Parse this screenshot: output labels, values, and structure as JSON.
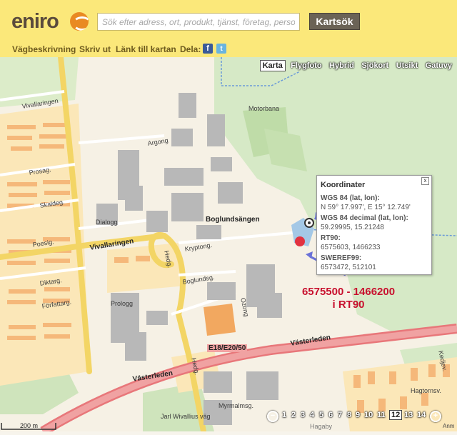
{
  "header": {
    "logo": "eniro",
    "search_placeholder": "Sök efter adress, ort, produkt, tjänst, företag, person",
    "search_button": "Kartsök"
  },
  "toolbar": {
    "directions": "Vägbeskrivning",
    "print": "Skriv ut",
    "link": "Länk till kartan",
    "share": "Dela:",
    "facebook": "f",
    "twitter": "t"
  },
  "map_types": [
    "Karta",
    "Flygfoto",
    "Hybrid",
    "Sjökort",
    "Utsikt",
    "Gatuvy"
  ],
  "map_labels": {
    "motorbana": "Motorbana",
    "vivallaringen_top": "Vivallaringen",
    "argong": "Argong",
    "prosag": "Prosag.",
    "skaldeg": "Skaldeg.",
    "dialogg": "Dialogg",
    "poesig": "Poesig.",
    "vivallaringen": "Vivallaringen",
    "hedg": "Hedg.",
    "kryptong": "Kryptong.",
    "boglundsangen": "Boglundsängen",
    "boglundsg": "Boglundsg.",
    "ozong": "Ozong",
    "diktarg": "Diktarg.",
    "prologg": "Prologg",
    "forfattarg": "Författarg.",
    "vasterleden_right": "Västerleden",
    "highway_badge": "E18/E20/50",
    "vasterleden_left": "Västerleden",
    "hedg2": "Hedg.",
    "myrmalmsg": "Myrmalmsg.",
    "jarn_wivallius": "Jarl Wivallius väg",
    "hagtornsv": "Hagtornsv.",
    "kedjev": "Kedjev."
  },
  "popup": {
    "title": "Koordinater",
    "close": "x",
    "wgs84_label": "WGS 84 (lat, lon):",
    "wgs84_value": "N 59° 17.997', E 15° 12.749'",
    "wgs84dec_label": "WGS 84 decimal (lat, lon):",
    "wgs84dec_value": "59.29995, 15.21248",
    "rt90_label": "RT90:",
    "rt90_value": "6575603, 1466233",
    "sweref_label": "SWEREF99:",
    "sweref_value": "6573472, 512101"
  },
  "annotation": {
    "line1": "6575500 - 1466200",
    "line2": "i RT90"
  },
  "zoom": {
    "levels": [
      "1",
      "2",
      "3",
      "4",
      "5",
      "6",
      "7",
      "8",
      "9",
      "10",
      "11",
      "12",
      "13",
      "14"
    ],
    "active": "12"
  },
  "scale": "200 m",
  "footer_place": "Hagaby",
  "footer_anm": "Anm",
  "colors": {
    "header_bg": "#fbe87a",
    "road_yellow": "#f3d565",
    "highway_red": "#e8777a",
    "park_green": "#d4e8c0",
    "building_gray": "#b3b3b3",
    "annotation_red": "#c8102e",
    "arrow_blue": "#6a72d8"
  }
}
